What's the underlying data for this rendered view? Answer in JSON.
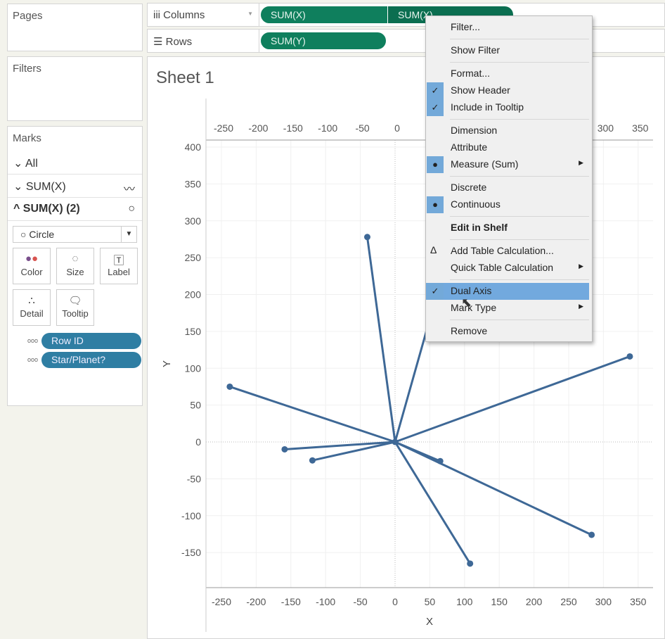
{
  "panels": {
    "pages": "Pages",
    "filters": "Filters",
    "marks": "Marks"
  },
  "shelves": {
    "columns_label": "Columns",
    "rows_label": "Rows",
    "columns_pills": [
      "SUM(X)",
      "SUM(X)"
    ],
    "rows_pills": [
      "SUM(Y)"
    ]
  },
  "marks": {
    "cards": [
      {
        "label": "All",
        "icon": "chevron-down"
      },
      {
        "label": "SUM(X)",
        "icon": "line"
      },
      {
        "label": "SUM(X) (2)",
        "icon": "circle"
      }
    ],
    "mark_type": "Circle",
    "buttons": [
      "Color",
      "Size",
      "Label",
      "Detail",
      "Tooltip"
    ],
    "fields": [
      "Row ID",
      "Star/Planet?"
    ]
  },
  "sheet_title": "Sheet 1",
  "menu": {
    "items": [
      {
        "label": "Filter..."
      },
      {
        "sep": true
      },
      {
        "label": "Show Filter"
      },
      {
        "sep": true
      },
      {
        "label": "Format..."
      },
      {
        "label": "Show Header",
        "mark": "✓"
      },
      {
        "label": "Include in Tooltip",
        "mark": "✓"
      },
      {
        "sep": true
      },
      {
        "label": "Dimension"
      },
      {
        "label": "Attribute"
      },
      {
        "label": "Measure (Sum)",
        "mark": "●",
        "submenu": true
      },
      {
        "sep": true
      },
      {
        "label": "Discrete"
      },
      {
        "label": "Continuous",
        "mark": "●"
      },
      {
        "sep": true
      },
      {
        "label": "Edit in Shelf",
        "bold": true
      },
      {
        "sep": true
      },
      {
        "label": "Add Table Calculation...",
        "icon": "Δ"
      },
      {
        "label": "Quick Table Calculation",
        "submenu": true
      },
      {
        "sep": true
      },
      {
        "label": "Dual Axis",
        "mark": "✓",
        "highlight": true
      },
      {
        "label": "Mark Type",
        "submenu": true
      },
      {
        "sep": true
      },
      {
        "label": "Remove"
      }
    ]
  },
  "chart_data": {
    "type": "line",
    "xlabel": "X",
    "ylabel": "Y",
    "xlim": [
      -260,
      370
    ],
    "ylim": [
      -190,
      410
    ],
    "xticks": [
      -250,
      -200,
      -150,
      -100,
      -50,
      0,
      50,
      100,
      150,
      200,
      250,
      300,
      350
    ],
    "yticks": [
      -150,
      -100,
      -50,
      0,
      50,
      100,
      150,
      200,
      250,
      300,
      350,
      400
    ],
    "center": [
      0,
      0
    ],
    "points": [
      [
        -40,
        278
      ],
      [
        -238,
        75
      ],
      [
        -159,
        -10
      ],
      [
        -119,
        -25
      ],
      [
        65,
        -26
      ],
      [
        283,
        -126
      ],
      [
        108,
        -165
      ],
      [
        338,
        116
      ],
      [
        60,
        200
      ]
    ],
    "color": "#3e6896"
  }
}
